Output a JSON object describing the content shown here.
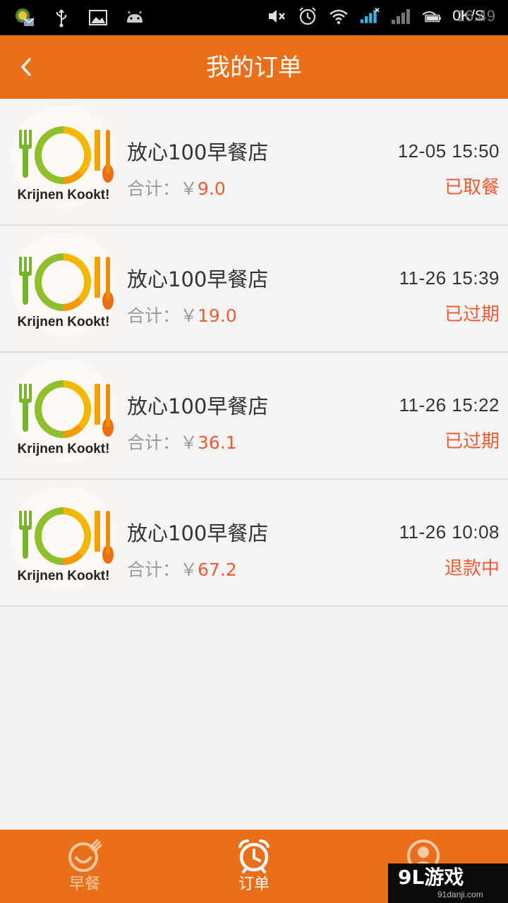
{
  "status_bar": {
    "net_speed": "0K/S",
    "time": "16:49"
  },
  "header": {
    "title": "我的订单"
  },
  "orders": [
    {
      "shop": "放心100早餐店",
      "total_label": "合计：￥",
      "amount": "9.0",
      "time": "12-05 15:50",
      "status": "已取餐",
      "logo_text": "Krijnen Kookt!"
    },
    {
      "shop": "放心100早餐店",
      "total_label": "合计：￥",
      "amount": "19.0",
      "time": "11-26 15:39",
      "status": "已过期",
      "logo_text": "Krijnen Kookt!"
    },
    {
      "shop": "放心100早餐店",
      "total_label": "合计：￥",
      "amount": "36.1",
      "time": "11-26 15:22",
      "status": "已过期",
      "logo_text": "Krijnen Kookt!"
    },
    {
      "shop": "放心100早餐店",
      "total_label": "合计：￥",
      "amount": "67.2",
      "time": "11-26 10:08",
      "status": "退款中",
      "logo_text": "Krijnen Kookt!"
    }
  ],
  "tabs": [
    {
      "label": "早餐",
      "icon": "breakfast-icon",
      "active": false
    },
    {
      "label": "订单",
      "icon": "alarm-clock-icon",
      "active": true
    },
    {
      "label": "",
      "icon": "profile-icon",
      "active": false
    }
  ],
  "watermark": {
    "main": "9L游戏",
    "sub": "91danji.com"
  },
  "colors": {
    "accent": "#ea6f1b",
    "price": "#ef5a32",
    "background": "#f2f2f2"
  }
}
